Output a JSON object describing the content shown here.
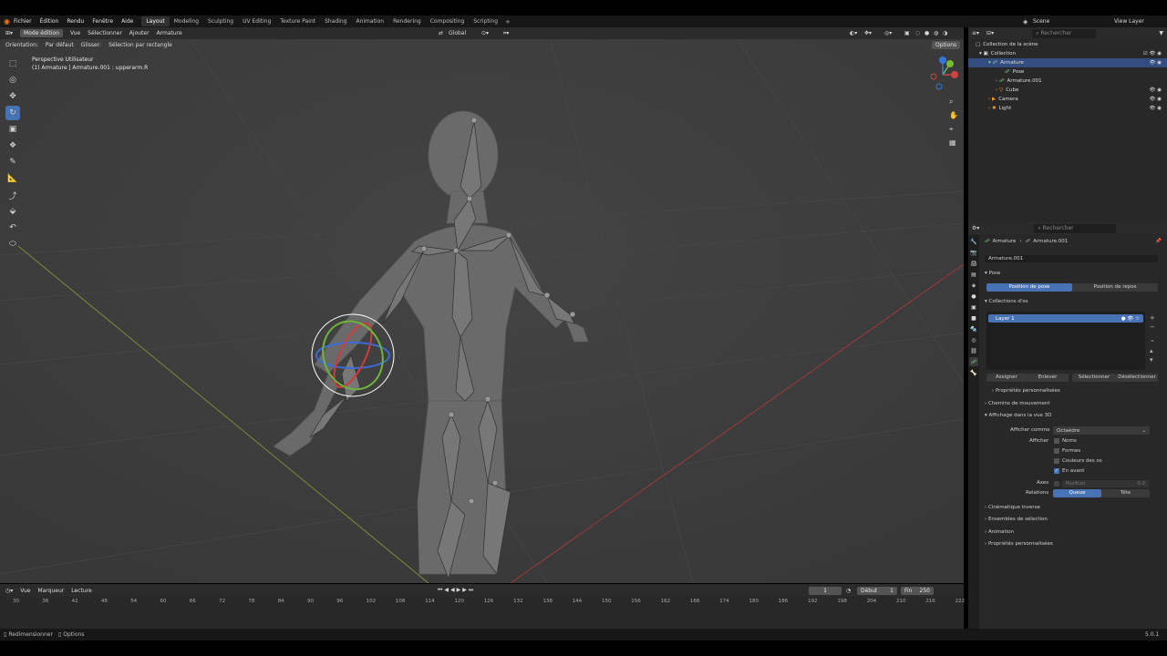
{
  "menubar": {
    "items": [
      "Fichier",
      "Édition",
      "Rendu",
      "Fenêtre",
      "Aide"
    ],
    "workspaces": [
      "Layout",
      "Modeling",
      "Sculpting",
      "UV Editing",
      "Texture Paint",
      "Shading",
      "Animation",
      "Rendering",
      "Compositing",
      "Scripting"
    ],
    "active_workspace": "Layout",
    "scene": "Scene",
    "view_layer": "View Layer"
  },
  "viewport_header": {
    "mode": "Mode édition",
    "menus": [
      "Vue",
      "Sélectionner",
      "Ajouter",
      "Armature"
    ],
    "transform": "Global",
    "options": "Options"
  },
  "viewport_header2": {
    "orientation_label": "Orientation:",
    "orientation_value": "Par défaut",
    "drag_label": "Glisser:",
    "drag_value": "Sélection par rectangle"
  },
  "viewport": {
    "view_name": "Perspective Utilisateur",
    "object_info": "(1) Armature | Armature.001 : upperarm.R"
  },
  "timeline": {
    "menus": [
      "Vue",
      "Marqueur",
      "Lecture"
    ],
    "current_frame": "1",
    "start_label": "Début",
    "start": "1",
    "end_label": "Fin",
    "end": "250",
    "ticks": [
      "30",
      "36",
      "42",
      "48",
      "54",
      "60",
      "66",
      "72",
      "78",
      "84",
      "90",
      "96",
      "102",
      "108",
      "114",
      "120",
      "126",
      "132",
      "138",
      "144",
      "150",
      "156",
      "162",
      "168",
      "174",
      "180",
      "186",
      "192",
      "198",
      "204",
      "210",
      "216",
      "222"
    ]
  },
  "statusbar": {
    "left": "Redimensionner",
    "left2": "Options",
    "version": "5.0.1"
  },
  "outliner": {
    "search_placeholder": "Rechercher",
    "root": "Collection de la scène",
    "rows": [
      {
        "label": "Collection",
        "indent": 0
      },
      {
        "label": "Armature",
        "indent": 1,
        "selected": true
      },
      {
        "label": "Pose",
        "indent": 2
      },
      {
        "label": "Armature.001",
        "indent": 2
      },
      {
        "label": "Cube",
        "indent": 2
      },
      {
        "label": "Camera",
        "indent": 1
      },
      {
        "label": "Light",
        "indent": 1
      }
    ]
  },
  "properties": {
    "search_placeholder": "Rechercher",
    "breadcrumb_1": "Armature",
    "breadcrumb_2": "Armature.001",
    "data_name": "Armature.001",
    "pose_section": "Pose",
    "pose_position": "Position de pose",
    "rest_position": "Position de repos",
    "bone_collections": "Collections d'os",
    "layer": "Layer 1",
    "assign": "Assigner",
    "remove": "Enlever",
    "select": "Sélectionner",
    "deselect": "Désélectionner",
    "custom_props_inner": "Propriétés personnalisées",
    "motion_paths": "Chemins de mouvement",
    "viewport_display": "Affichage dans la vue 3D",
    "display_as_label": "Afficher comme",
    "display_as_value": "Octaèdre",
    "show_label": "Afficher",
    "names": "Noms",
    "shapes": "Formes",
    "bone_colors": "Couleurs des os",
    "in_front": "En avant",
    "axes_label": "Axes",
    "axes_position_label": "Position",
    "axes_position_value": "0.0",
    "relations_label": "Relations",
    "relation_tail": "Queue",
    "relation_head": "Tête",
    "inverse_kinematics": "Cinématique inverse",
    "selection_sets": "Ensembles de sélection",
    "animation": "Animation",
    "custom_props": "Propriétés personnalisées"
  }
}
